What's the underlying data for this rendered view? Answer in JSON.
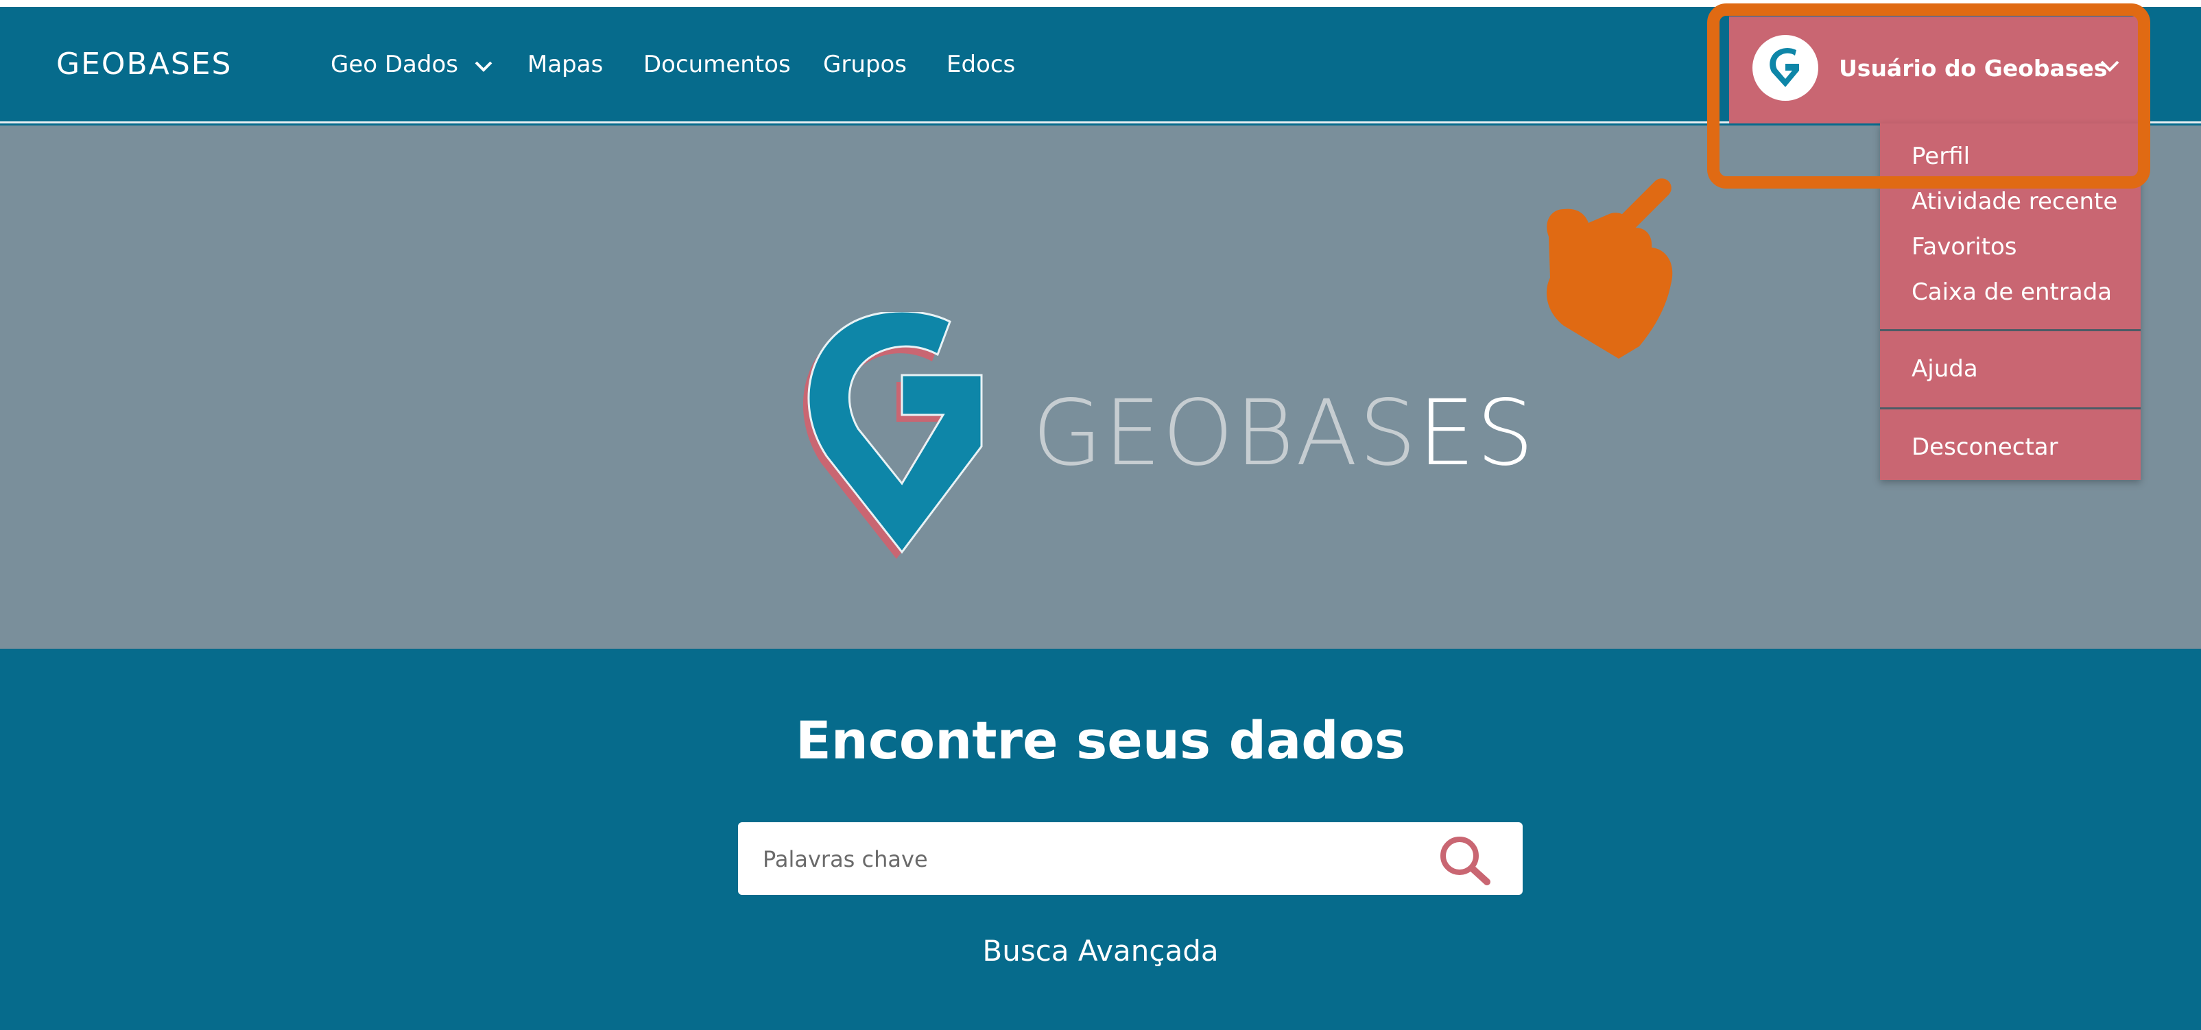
{
  "navbar": {
    "brand": "GEOBASES",
    "links": [
      {
        "label": "Geo Dados"
      },
      {
        "label": "Mapas"
      },
      {
        "label": "Documentos"
      },
      {
        "label": "Grupos"
      },
      {
        "label": "Edocs"
      }
    ],
    "user_label": "Usuário do Geobases"
  },
  "user_menu": {
    "items": [
      "Perfil",
      "Atividade recente",
      "Favoritos",
      "Caixa de entrada",
      "Ajuda",
      "Desconectar"
    ]
  },
  "hero": {
    "title_part1": "GEOBAS",
    "title_part2": "ES"
  },
  "search": {
    "heading": "Encontre seus dados",
    "placeholder": "Palavras chave",
    "advanced_label": "Busca Avançada"
  },
  "icons": {
    "chevron": "chevron-down-icon",
    "avatar": "geobases-g-icon",
    "search": "search-icon",
    "annotation": "pointing-hand-icon"
  },
  "colors": {
    "brand_blue": "#066b8c",
    "hero_gray": "#7a8f9b",
    "menu_pink": "#c96672",
    "annotation_orange": "#e06a13",
    "logo_teal": "#0e86a8"
  }
}
